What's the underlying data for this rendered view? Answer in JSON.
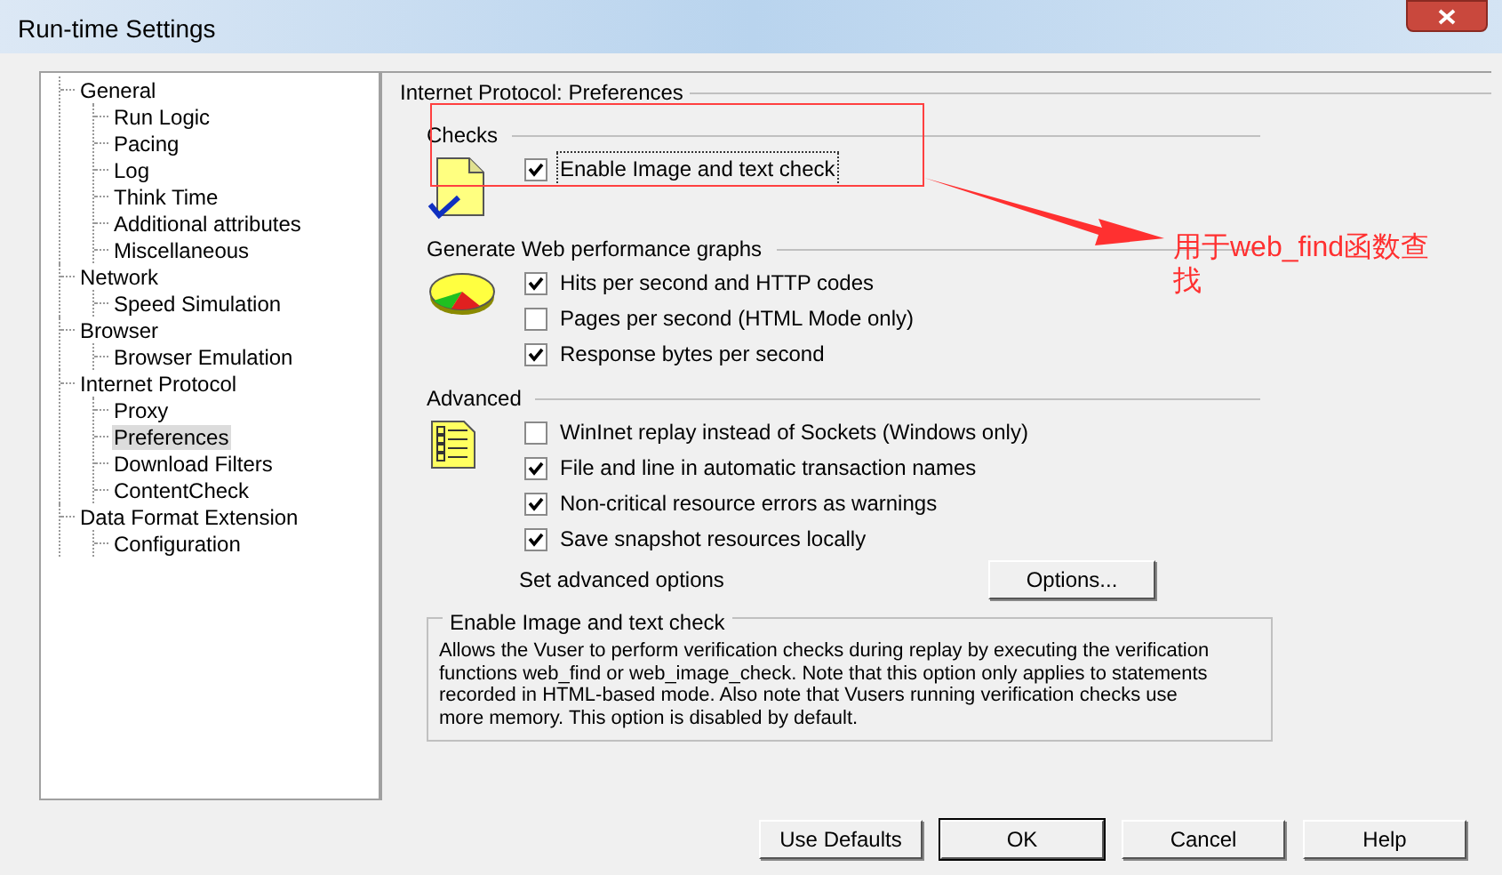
{
  "window": {
    "title": "Run-time Settings"
  },
  "tree": [
    {
      "label": "General",
      "selected": false,
      "children": [
        {
          "label": "Run Logic",
          "selected": false
        },
        {
          "label": "Pacing",
          "selected": false
        },
        {
          "label": "Log",
          "selected": false
        },
        {
          "label": "Think Time",
          "selected": false
        },
        {
          "label": "Additional attributes",
          "selected": false
        },
        {
          "label": "Miscellaneous",
          "selected": false
        }
      ]
    },
    {
      "label": "Network",
      "selected": false,
      "children": [
        {
          "label": "Speed Simulation",
          "selected": false
        }
      ]
    },
    {
      "label": "Browser",
      "selected": false,
      "children": [
        {
          "label": "Browser Emulation",
          "selected": false
        }
      ]
    },
    {
      "label": "Internet Protocol",
      "selected": false,
      "children": [
        {
          "label": "Proxy",
          "selected": false
        },
        {
          "label": "Preferences",
          "selected": true
        },
        {
          "label": "Download Filters",
          "selected": false
        },
        {
          "label": "ContentCheck",
          "selected": false
        }
      ]
    },
    {
      "label": "Data Format Extension",
      "selected": false,
      "children": [
        {
          "label": "Configuration",
          "selected": false
        }
      ]
    }
  ],
  "panel": {
    "title": "Internet Protocol: Preferences",
    "sections": [
      {
        "title": "Checks",
        "kind": "checks",
        "options": [
          {
            "label": "Enable Image and text check",
            "checked": true,
            "focused": true
          }
        ]
      },
      {
        "title": "Generate Web performance graphs",
        "kind": "graphs",
        "options": [
          {
            "label": "Hits per second and HTTP codes",
            "checked": true,
            "focused": false
          },
          {
            "label": "Pages per second (HTML Mode only)",
            "checked": false,
            "focused": false
          },
          {
            "label": "Response bytes per second",
            "checked": true,
            "focused": false
          }
        ]
      },
      {
        "title": "Advanced",
        "kind": "advanced",
        "options": [
          {
            "label": "WinInet replay instead of Sockets (Windows only)",
            "checked": false,
            "focused": false
          },
          {
            "label": "File and line in automatic transaction names",
            "checked": true,
            "focused": false
          },
          {
            "label": "Non-critical resource errors as warnings",
            "checked": true,
            "focused": false
          },
          {
            "label": "Save snapshot resources locally",
            "checked": true,
            "focused": false
          }
        ]
      }
    ],
    "advanced_label": "Set advanced options",
    "options_button": "Options...",
    "description": {
      "title": "Enable Image and text check",
      "text": "Allows the Vuser to perform verification checks during replay by executing the verification functions web_find or web_image_check. Note that this option only applies to statements recorded in HTML-based mode. Also note that Vusers running verification checks use more memory. This option is disabled by default."
    }
  },
  "buttons": [
    "Use Defaults",
    "OK",
    "Cancel",
    "Help"
  ],
  "annotation": {
    "text": "用于web_find函数查找"
  }
}
